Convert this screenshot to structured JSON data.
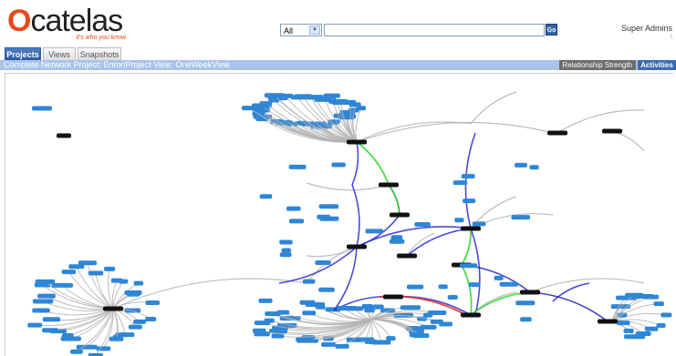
{
  "header": {
    "logo_text": "catelas",
    "logo_tagline": "it's who you know",
    "search_scope": "All",
    "search_placeholder": "",
    "go_label": "Go",
    "user_name": "Super Admins",
    "user_sub": "\\"
  },
  "tabs": [
    {
      "label": "Projects",
      "active": true
    },
    {
      "label": "Views",
      "active": false
    },
    {
      "label": "Snapshots",
      "active": false
    }
  ],
  "subbar": {
    "breadcrumb": "Complete Network  Project: EnronProject  View: OneWeekView",
    "relationship_label": "Relationship Strength",
    "activities_label": "Activities"
  },
  "colors": {
    "edge_default": "#b3b3b3",
    "edge_blue": "#2b2bcf",
    "edge_green": "#2ad62a",
    "edge_red": "#e23030",
    "node_blue": "#2e86d6",
    "node_dark": "#111111",
    "tab_active": "#2b5aa0",
    "bar": "#a9c3ea"
  }
}
